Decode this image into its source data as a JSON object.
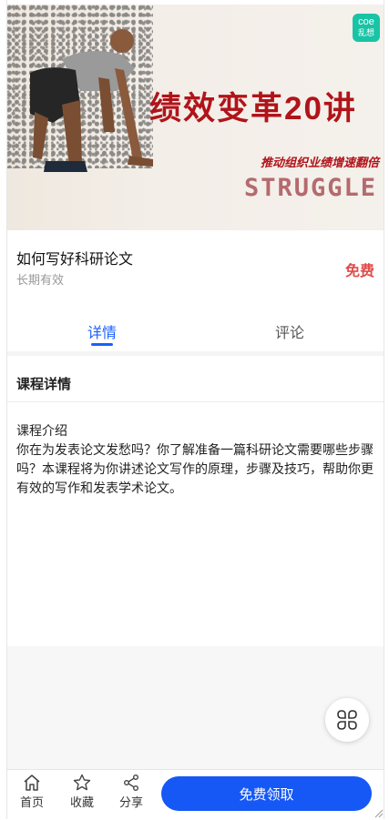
{
  "banner": {
    "title": "绩效变革20讲",
    "subtitle": "推动组织业绩增速翻倍",
    "tagline": "STRUGGLE",
    "logo_top": "coe",
    "logo_bottom": "乱想"
  },
  "course": {
    "title": "如何写好科研论文",
    "validity": "长期有效",
    "price": "免费"
  },
  "tabs": [
    {
      "label": "详情",
      "active": true
    },
    {
      "label": "评论",
      "active": false
    }
  ],
  "details": {
    "heading": "课程详情",
    "intro_label": "课程介绍",
    "intro_text": "你在为发表论文发愁吗？你了解准备一篇科研论文需要哪些步骤吗？本课程将为你讲述论文写作的原理，步骤及技巧，帮助你更有效的写作和发表学术论文。"
  },
  "bottom_nav": {
    "home": "首页",
    "favorite": "收藏",
    "share": "分享",
    "cta": "免费领取"
  },
  "colors": {
    "accent": "#1658f5",
    "price": "#e24b4b",
    "banner_red": "#b0141a",
    "logo": "#19c4a6"
  },
  "icons": [
    "home-icon",
    "star-icon",
    "share-icon",
    "grid-icon",
    "resize-grip-icon"
  ]
}
